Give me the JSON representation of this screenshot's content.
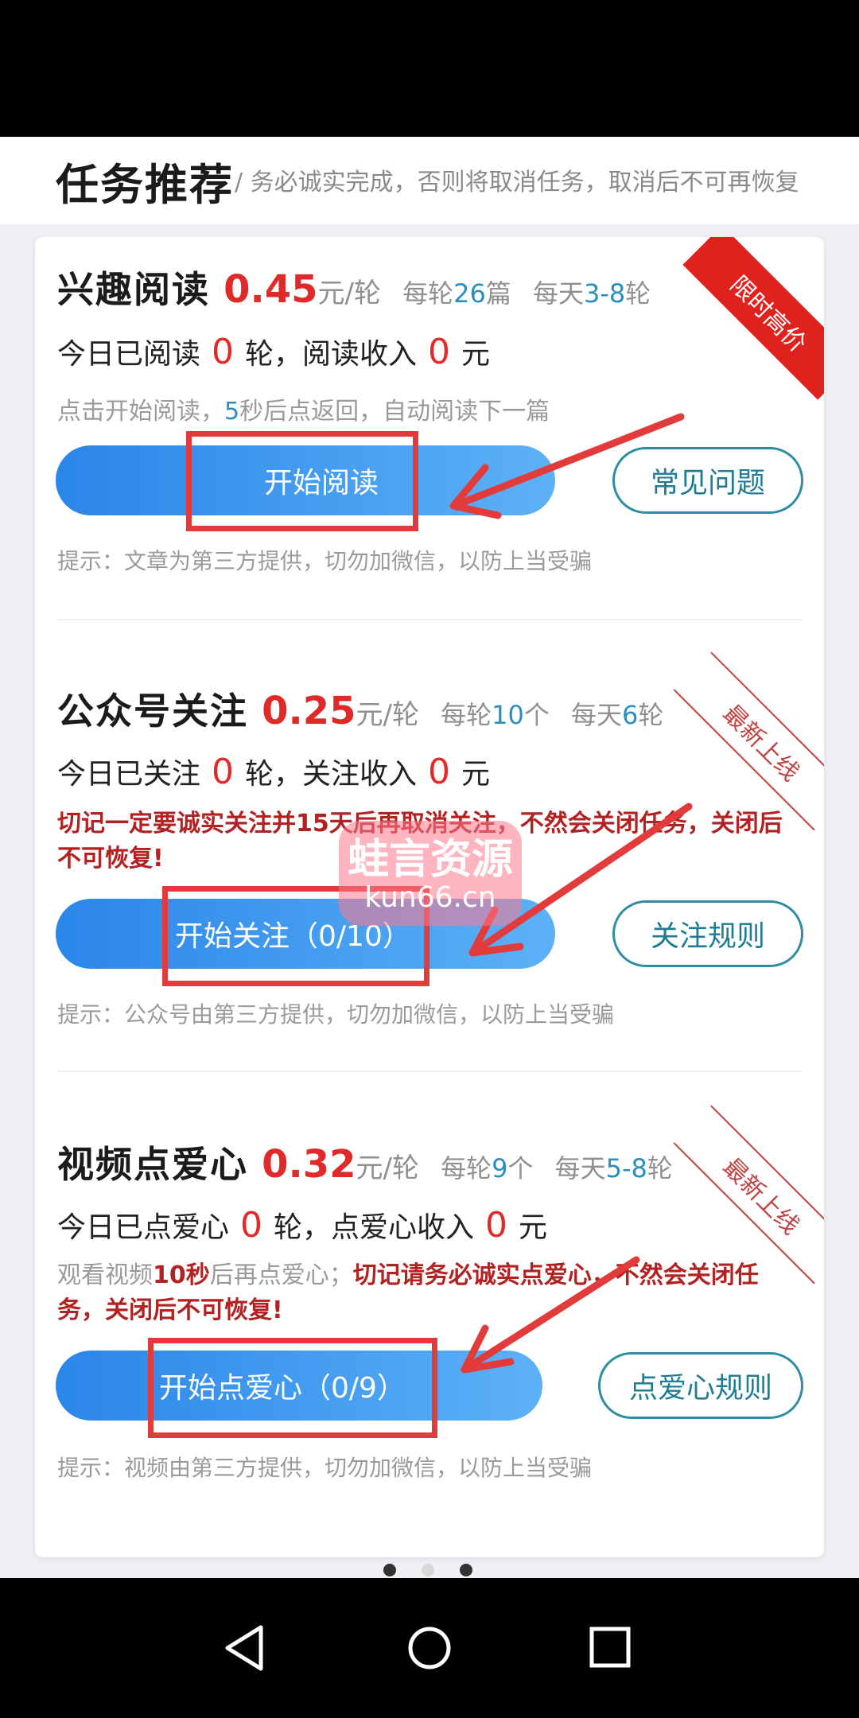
{
  "header": {
    "title": "任务推荐",
    "subtitle": "/ 务必诚实完成，否则将取消任务，取消后不可再恢复"
  },
  "tasks": [
    {
      "name": "兴趣阅读",
      "price": "0.45",
      "unit": "元/轮",
      "meta1_prefix": "每轮",
      "meta1_num": "26",
      "meta1_suffix": "篇",
      "meta2_prefix": "每天",
      "meta2_num": "3-8",
      "meta2_suffix": "轮",
      "ribbon": "限时高价",
      "today_prefix": "今日已阅读",
      "today_count": "0",
      "today_mid": "轮，阅读收入",
      "today_income": "0",
      "today_suffix": "元",
      "hint_a": "点击开始阅读，",
      "hint_num": "5",
      "hint_b": "秒后点返回，自动阅读下一篇",
      "primary_label": "开始阅读",
      "secondary_label": "常见问题",
      "tip": "提示：文章为第三方提供，切勿加微信，以防上当受骗"
    },
    {
      "name": "公众号关注",
      "price": "0.25",
      "unit": "元/轮",
      "meta1_prefix": "每轮",
      "meta1_num": "10",
      "meta1_suffix": "个",
      "meta2_prefix": "每天",
      "meta2_num": "6",
      "meta2_suffix": "轮",
      "ribbon": "最新上线",
      "today_prefix": "今日已关注",
      "today_count": "0",
      "today_mid": "轮，关注收入",
      "today_income": "0",
      "today_suffix": "元",
      "warning": "切记一定要诚实关注并15天后再取消关注，不然会关闭任务，关闭后不可恢复!",
      "primary_label": "开始关注（0/10）",
      "secondary_label": "关注规则",
      "tip": "提示：公众号由第三方提供，切勿加微信，以防上当受骗"
    },
    {
      "name": "视频点爱心",
      "price": "0.32",
      "unit": "元/轮",
      "meta1_prefix": "每轮",
      "meta1_num": "9",
      "meta1_suffix": "个",
      "meta2_prefix": "每天",
      "meta2_num": "5-8",
      "meta2_suffix": "轮",
      "ribbon": "最新上线",
      "today_prefix": "今日已点爱心",
      "today_count": "0",
      "today_mid": "轮，点爱心收入",
      "today_income": "0",
      "today_suffix": "元",
      "warning_grey": "观看视频",
      "warning_num": "10秒",
      "warning_grey2": "后再点爱心；",
      "warning": "切记请务必诚实点爱心，不然会关闭任务，关闭后不可恢复!",
      "primary_label": "开始点爱心（0/9）",
      "secondary_label": "点爱心规则",
      "tip": "提示：视频由第三方提供，切勿加微信，以防上当受骗"
    }
  ],
  "watermark": {
    "line1": "蛙言资源",
    "line2": "kun66.cn"
  },
  "pager": {
    "count": 3,
    "active_index": 2
  },
  "navbar": {
    "icons": [
      "back-icon",
      "home-icon",
      "recents-icon"
    ]
  },
  "colors": {
    "price": "#e02a2a",
    "accent_blue": "#2a86e8",
    "annotation_red": "#e23b3b"
  }
}
